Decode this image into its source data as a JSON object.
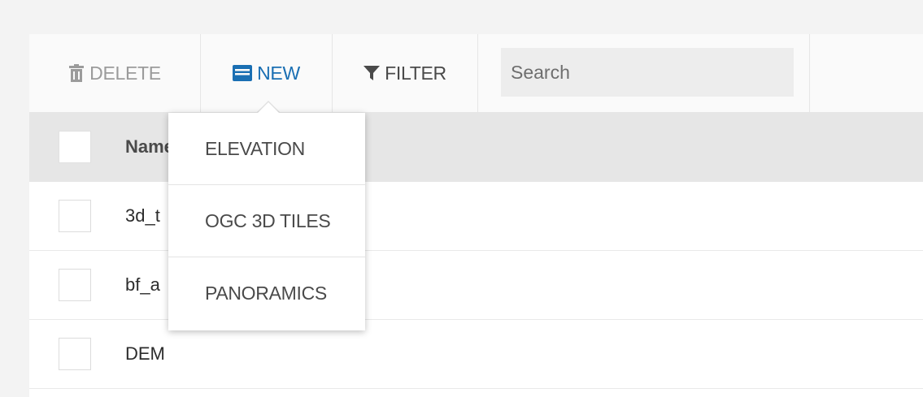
{
  "toolbar": {
    "delete_label": "DELETE",
    "new_label": "NEW",
    "filter_label": "FILTER",
    "search_placeholder": "Search"
  },
  "table": {
    "header": {
      "name": "Name"
    },
    "rows": [
      {
        "name": "3d_t"
      },
      {
        "name": "bf_a"
      },
      {
        "name": "DEM"
      }
    ]
  },
  "new_menu": {
    "items": [
      {
        "label": "ELEVATION"
      },
      {
        "label": "OGC 3D TILES"
      },
      {
        "label": "PANORAMICS"
      }
    ]
  },
  "icons": {
    "delete": "trash-icon",
    "new": "layer-icon",
    "filter": "funnel-icon"
  },
  "colors": {
    "accent": "#1a6fb3",
    "disabled_text": "#9b9b9b",
    "header_bg": "#e6e6e6",
    "toolbar_bg": "#fafafa"
  }
}
